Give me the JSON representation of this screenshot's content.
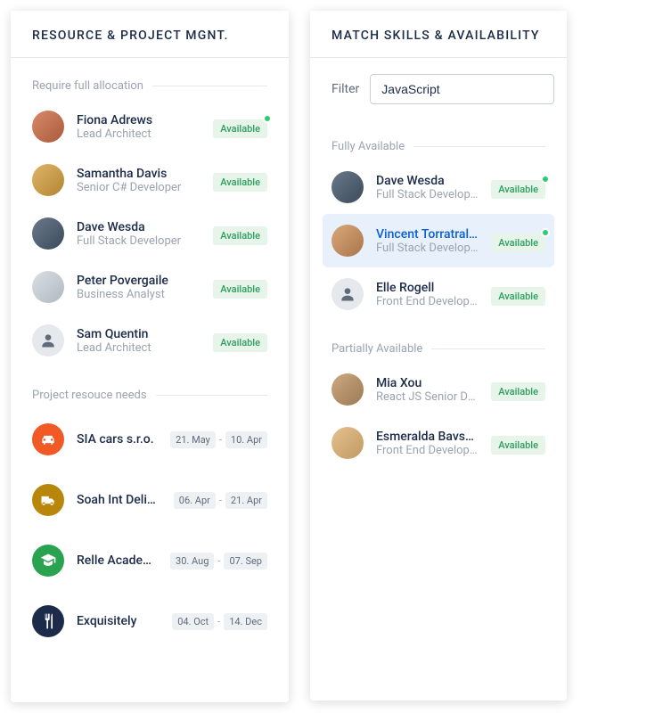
{
  "left": {
    "title": "RESOURCE & PROJECT MGNT.",
    "section_allocation": "Require full allocation",
    "people": [
      {
        "name": "Fiona Adrews",
        "role": "Lead Architect",
        "badge": "Available",
        "dot": true
      },
      {
        "name": "Samantha Davis",
        "role": "Senior C# Developer",
        "badge": "Available",
        "dot": false
      },
      {
        "name": "Dave Wesda",
        "role": "Full Stack Developer",
        "badge": "Available",
        "dot": false
      },
      {
        "name": "Peter Povergaile",
        "role": "Business Analyst",
        "badge": "Available",
        "dot": false
      },
      {
        "name": "Sam Quentin",
        "role": "Lead Architect",
        "badge": "Available",
        "dot": false
      }
    ],
    "section_projects": "Project resouce needs",
    "projects": [
      {
        "name": "SIA cars s.r.o.",
        "start": "21. May",
        "end": "10. Apr"
      },
      {
        "name": "Soah Int Deliveries",
        "start": "06. Apr",
        "end": "21. Apr"
      },
      {
        "name": "Relle Academy",
        "start": "30. Aug",
        "end": "07. Sep"
      },
      {
        "name": "Exquisitely",
        "start": "04. Oct",
        "end": "14. Dec"
      }
    ]
  },
  "right": {
    "title": "MATCH SKILLS & AVAILABILITY",
    "filter_label": "Filter",
    "filter_value": "JavaScript",
    "section_full": "Fully Available",
    "full": [
      {
        "name": "Dave Wesda",
        "role": "Full Stack Developer",
        "badge": "Available",
        "dot": true,
        "selected": false
      },
      {
        "name": "Vincent Torratrallie",
        "role": "Full Stack Developer",
        "badge": "Available",
        "dot": true,
        "selected": true
      },
      {
        "name": "Elle Rogell",
        "role": "Front End Developer",
        "badge": "Available",
        "dot": false,
        "selected": false
      }
    ],
    "section_partial": "Partially Available",
    "partial": [
      {
        "name": "Mia Xou",
        "role": "React JS Senior Devel...",
        "badge": "Available",
        "dot": false
      },
      {
        "name": "Esmeralda Bavskaris",
        "role": "Front End Developer",
        "badge": "Available",
        "dot": false
      }
    ]
  }
}
